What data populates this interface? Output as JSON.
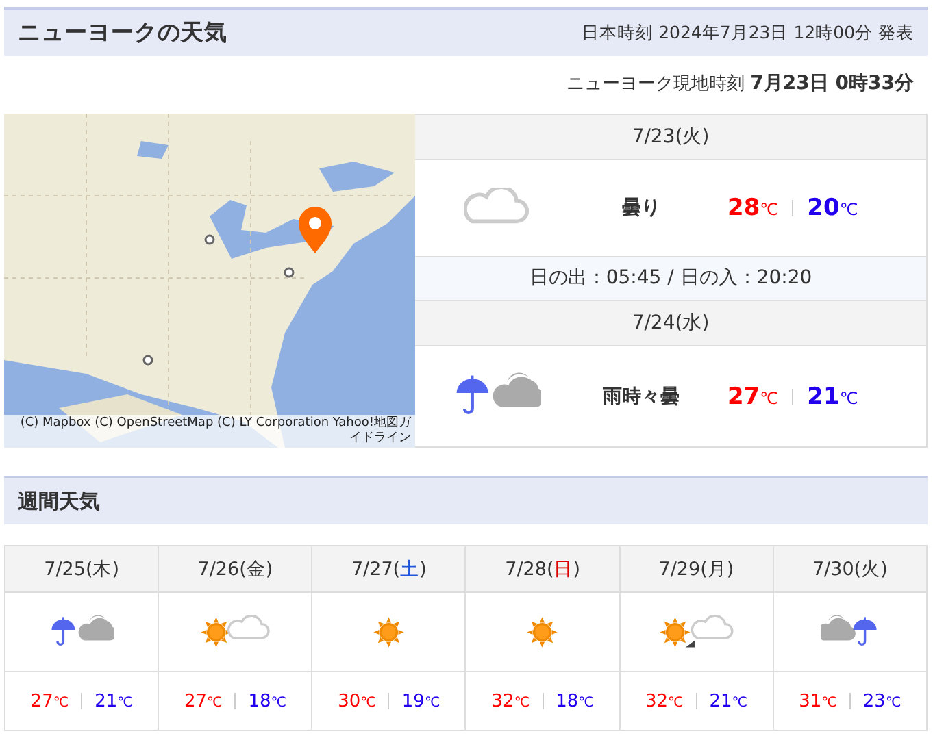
{
  "header": {
    "title": "ニューヨークの天気",
    "issued": "日本時刻 2024年7月23日 12時00分 発表"
  },
  "local_time": {
    "label": "ニューヨーク現地時刻",
    "value": "7月23日 0時33分"
  },
  "map": {
    "attribution": "(C) Mapbox (C) OpenStreetMap (C) LY Corporation Yahoo!地図ガイドライン"
  },
  "forecast": [
    {
      "date": "7/23(火)",
      "kind": "cloud",
      "weather": "曇り",
      "high": "28",
      "high_unit": "℃",
      "low": "20",
      "low_unit": "℃"
    },
    {
      "date": "7/24(水)",
      "kind": "rain_cloud",
      "weather": "雨時々曇",
      "high": "27",
      "high_unit": "℃",
      "low": "21",
      "low_unit": "℃"
    }
  ],
  "sun": "日の出：05:45 / 日の入：20:20",
  "weekly": {
    "title": "週間天気",
    "days": [
      {
        "date": "7/25(",
        "weekday": "木",
        "close": ")",
        "color": "#333333",
        "kind": "rain_cloud",
        "high": "27",
        "high_unit": "℃",
        "low": "21",
        "low_unit": "℃"
      },
      {
        "date": "7/26(",
        "weekday": "金",
        "close": ")",
        "color": "#333333",
        "kind": "sun_cloud",
        "high": "27",
        "high_unit": "℃",
        "low": "18",
        "low_unit": "℃"
      },
      {
        "date": "7/27(",
        "weekday": "土",
        "close": ")",
        "color": "#2255dd",
        "kind": "sun",
        "high": "30",
        "high_unit": "℃",
        "low": "19",
        "low_unit": "℃"
      },
      {
        "date": "7/28(",
        "weekday": "日",
        "close": ")",
        "color": "#dd0000",
        "kind": "sun",
        "high": "32",
        "high_unit": "℃",
        "low": "18",
        "low_unit": "℃"
      },
      {
        "date": "7/29(",
        "weekday": "月",
        "close": ")",
        "color": "#333333",
        "kind": "sun_then_cloud",
        "high": "32",
        "high_unit": "℃",
        "low": "21",
        "low_unit": "℃"
      },
      {
        "date": "7/30(",
        "weekday": "火",
        "close": ")",
        "color": "#333333",
        "kind": "cloud_rain",
        "high": "31",
        "high_unit": "℃",
        "low": "23",
        "low_unit": "℃"
      }
    ]
  }
}
